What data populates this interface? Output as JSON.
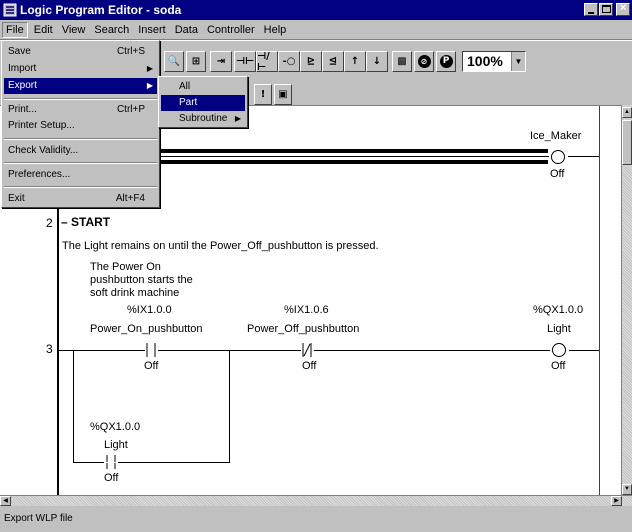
{
  "window": {
    "title": "Logic Program Editor - soda"
  },
  "menubar": [
    "File",
    "Edit",
    "View",
    "Search",
    "Insert",
    "Data",
    "Controller",
    "Help"
  ],
  "file_menu": {
    "items": [
      {
        "label": "Save",
        "shortcut": "Ctrl+S"
      },
      {
        "label": "Import"
      },
      {
        "label": "Export"
      },
      {
        "label": "Print...",
        "shortcut": "Ctrl+P"
      },
      {
        "label": "Printer Setup..."
      },
      {
        "label": "Check Validity..."
      },
      {
        "label": "Preferences..."
      },
      {
        "label": "Exit",
        "shortcut": "Alt+F4"
      }
    ]
  },
  "export_submenu": {
    "items": [
      {
        "label": "All"
      },
      {
        "label": "Part"
      },
      {
        "label": "Subroutine"
      }
    ]
  },
  "toolbar": {
    "zoom": "100%"
  },
  "rung1": {
    "coil_label": "Ice_Maker",
    "coil_state": "Off"
  },
  "rung2": {
    "number": "2",
    "heading": "START",
    "comment": "The Light remains on until the Power_Off_pushbutton is pressed."
  },
  "rung3": {
    "number": "3",
    "note_line1": "The Power On",
    "note_line2": "pushbutton starts the",
    "note_line3": "soft drink machine",
    "contact1": {
      "address": "%IX1.0.0",
      "name": "Power_On_pushbutton",
      "state": "Off"
    },
    "contact2": {
      "address": "%IX1.0.6",
      "name": "Power_Off_pushbutton",
      "state": "Off"
    },
    "coil": {
      "address": "%QX1.0.0",
      "name": "Light",
      "state": "Off"
    },
    "branch": {
      "address": "%QX1.0.0",
      "name": "Light",
      "state": "Off"
    }
  },
  "statusbar": {
    "text": "Export WLP file"
  }
}
